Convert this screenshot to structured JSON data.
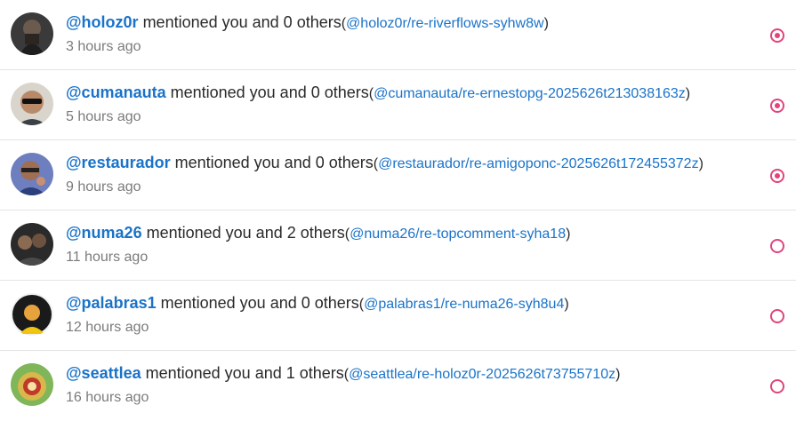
{
  "colors": {
    "username": "#1a73c9",
    "accent": "#e0457b",
    "time": "#7b7b7b"
  },
  "notifications": [
    {
      "username": "@holoz0r",
      "message": " mentioned you and 0 others",
      "link": "@holoz0r/re-riverflows-syhw8w",
      "time": "3 hours ago",
      "unread": true
    },
    {
      "username": "@cumanauta",
      "message": " mentioned you and 0 others",
      "link": "@cumanauta/re-ernestopg-2025626t213038163z",
      "time": "5 hours ago",
      "unread": true
    },
    {
      "username": "@restaurador",
      "message": " mentioned you and 0 others",
      "link": "@restaurador/re-amigoponc-2025626t172455372z",
      "time": "9 hours ago",
      "unread": true
    },
    {
      "username": "@numa26",
      "message": " mentioned you and 2 others",
      "link": "@numa26/re-topcomment-syha18",
      "time": "11 hours ago",
      "unread": false
    },
    {
      "username": "@palabras1",
      "message": " mentioned you and 0 others",
      "link": "@palabras1/re-numa26-syh8u4",
      "time": "12 hours ago",
      "unread": false
    },
    {
      "username": "@seattlea",
      "message": " mentioned you and 1 others",
      "link": "@seattlea/re-holoz0r-2025626t73755710z",
      "time": "16 hours ago",
      "unread": false
    }
  ]
}
